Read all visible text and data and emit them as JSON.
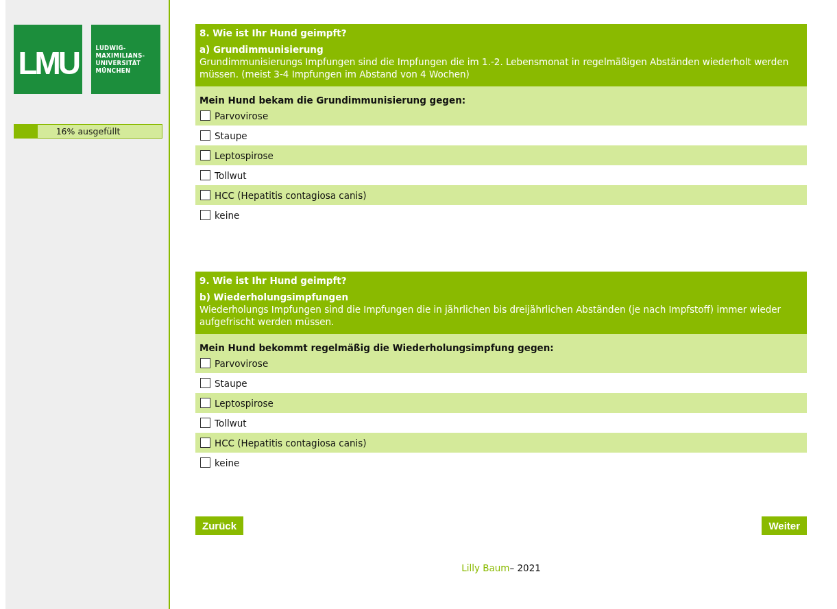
{
  "logo": {
    "mark": "LMU",
    "name_lines": [
      "LUDWIG-",
      "MAXIMILIANS-",
      "UNIVERSITÄT",
      "MÜNCHEN"
    ]
  },
  "progress": {
    "level": 0.16,
    "label": "16% ausgefüllt"
  },
  "questions": [
    {
      "title": "8. Wie ist Ihr Hund geimpft?",
      "subtitle": "a) Grundimmunisierung",
      "description": "Grundimmunisierungs Impfungen sind die Impfungen die im 1.-2. Lebensmonat in regelmäßigen Abständen wiederholt werden müssen. (meist 3-4 Impfungen im Abstand von 4 Wochen)",
      "prompt": "Mein Hund bekam die Grundimmunisierung gegen:",
      "options": [
        {
          "label": "Parvovirose",
          "checked": false
        },
        {
          "label": "Staupe",
          "checked": false
        },
        {
          "label": "Leptospirose",
          "checked": false
        },
        {
          "label": "Tollwut",
          "checked": false
        },
        {
          "label": "HCC (Hepatitis contagiosa canis)",
          "checked": false
        },
        {
          "label": "keine",
          "checked": false
        }
      ]
    },
    {
      "title": "9. Wie ist Ihr Hund geimpft?",
      "subtitle": "b) Wiederholungsimpfungen",
      "description": "Wiederholungs Impfungen sind die Impfungen die in jährlichen bis dreijährlichen Abständen (je nach Impfstoff) immer wieder aufgefrischt werden müssen.",
      "prompt": "Mein Hund bekommt regelmäßig die Wiederholungsimpfung gegen:",
      "options": [
        {
          "label": "Parvovirose",
          "checked": false
        },
        {
          "label": "Staupe",
          "checked": false
        },
        {
          "label": "Leptospirose",
          "checked": false
        },
        {
          "label": "Tollwut",
          "checked": false
        },
        {
          "label": "HCC (Hepatitis contagiosa canis)",
          "checked": false
        },
        {
          "label": "keine",
          "checked": false
        }
      ]
    }
  ],
  "buttons": {
    "back": "Zurück",
    "next": "Weiter"
  },
  "footer": {
    "author": "Lilly Baum",
    "year": "– 2021"
  }
}
